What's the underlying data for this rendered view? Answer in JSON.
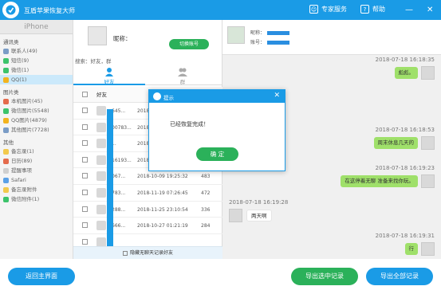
{
  "app": {
    "title": "互盾苹果恢复大师",
    "expert_label": "专家服务",
    "help_label": "帮助"
  },
  "sidebar": {
    "device": "iPhone",
    "sections": [
      {
        "label": "通讯类",
        "items": [
          {
            "label": "联系人(49)",
            "color": "#7a9cc6"
          },
          {
            "label": "短信(9)",
            "color": "#3cc36b"
          },
          {
            "label": "微信(1)",
            "color": "#3cc36b"
          },
          {
            "label": "QQ(1)",
            "color": "#f2b31e",
            "active": true
          }
        ]
      },
      {
        "label": "图片类",
        "items": [
          {
            "label": "本机图片(45)",
            "color": "#e46b4c"
          },
          {
            "label": "微信图片(5548)",
            "color": "#3cc36b"
          },
          {
            "label": "QQ图片(4879)",
            "color": "#f2b31e"
          },
          {
            "label": "其他图片(7728)",
            "color": "#7a9cc6"
          }
        ]
      },
      {
        "label": "其他",
        "items": [
          {
            "label": "备忘录(1)",
            "color": "#f2c94c"
          },
          {
            "label": "日历(89)",
            "color": "#e46b4c"
          },
          {
            "label": "提醒事项",
            "color": "#cfcfcf"
          },
          {
            "label": "Safari",
            "color": "#5aa0e6"
          },
          {
            "label": "备忘录附件",
            "color": "#f2c94c"
          },
          {
            "label": "微信附件(1)",
            "color": "#3cc36b"
          }
        ]
      }
    ]
  },
  "middle": {
    "nickname_label": "昵称：",
    "switch_label": "切换账号",
    "search_label": "搜索：好友，群",
    "tab_friend": "好友",
    "tab_group": "群",
    "col_friend": "好友",
    "rows": [
      {
        "id": "645...",
        "time": "2018-",
        "count": ""
      },
      {
        "id": "00783...",
        "time": "2018-",
        "count": ""
      },
      {
        "id": "...",
        "time": "2018-",
        "count": ""
      },
      {
        "id": "16193...",
        "time": "2018-",
        "count": ""
      },
      {
        "id": "067...",
        "time": "2018-10-09 19:25:32",
        "count": "483"
      },
      {
        "id": "783...",
        "time": "2018-11-19 07:26:45",
        "count": "472"
      },
      {
        "id": "288...",
        "time": "2018-11-25 23:10:54",
        "count": "336"
      },
      {
        "id": "666...",
        "time": "2018-10-27 01:21:19",
        "count": "284"
      },
      {
        "id": "",
        "time": "",
        "count": ""
      }
    ],
    "hide_label": "隐藏无聊天记录好友"
  },
  "chat": {
    "nick_label": "昵称：",
    "acct_label": "账号：",
    "messages": [
      {
        "time": "2018-07-18 16:18:35",
        "text": "彪彪。",
        "side": "me"
      },
      {
        "time": "2018-07-18 16:18:53",
        "text": "周末休息几天的",
        "side": "me"
      },
      {
        "time": "2018-07-18 16:19:23",
        "text": "在这停着无聊 准备来找你玩。",
        "side": "me"
      },
      {
        "time": "2018-07-18 16:19:28",
        "text": "两天啊",
        "side": "other"
      },
      {
        "time": "2018-07-18 16:19:31",
        "text": "行",
        "side": "me"
      }
    ]
  },
  "footer": {
    "back": "返回主界面",
    "export_selected": "导出选中记录",
    "export_all": "导出全部记录"
  },
  "dialog": {
    "title": "提示",
    "message": "已经恢复完成！",
    "ok": "确 定"
  },
  "colors": {
    "primary": "#1a9be6",
    "green": "#2bb15a"
  }
}
